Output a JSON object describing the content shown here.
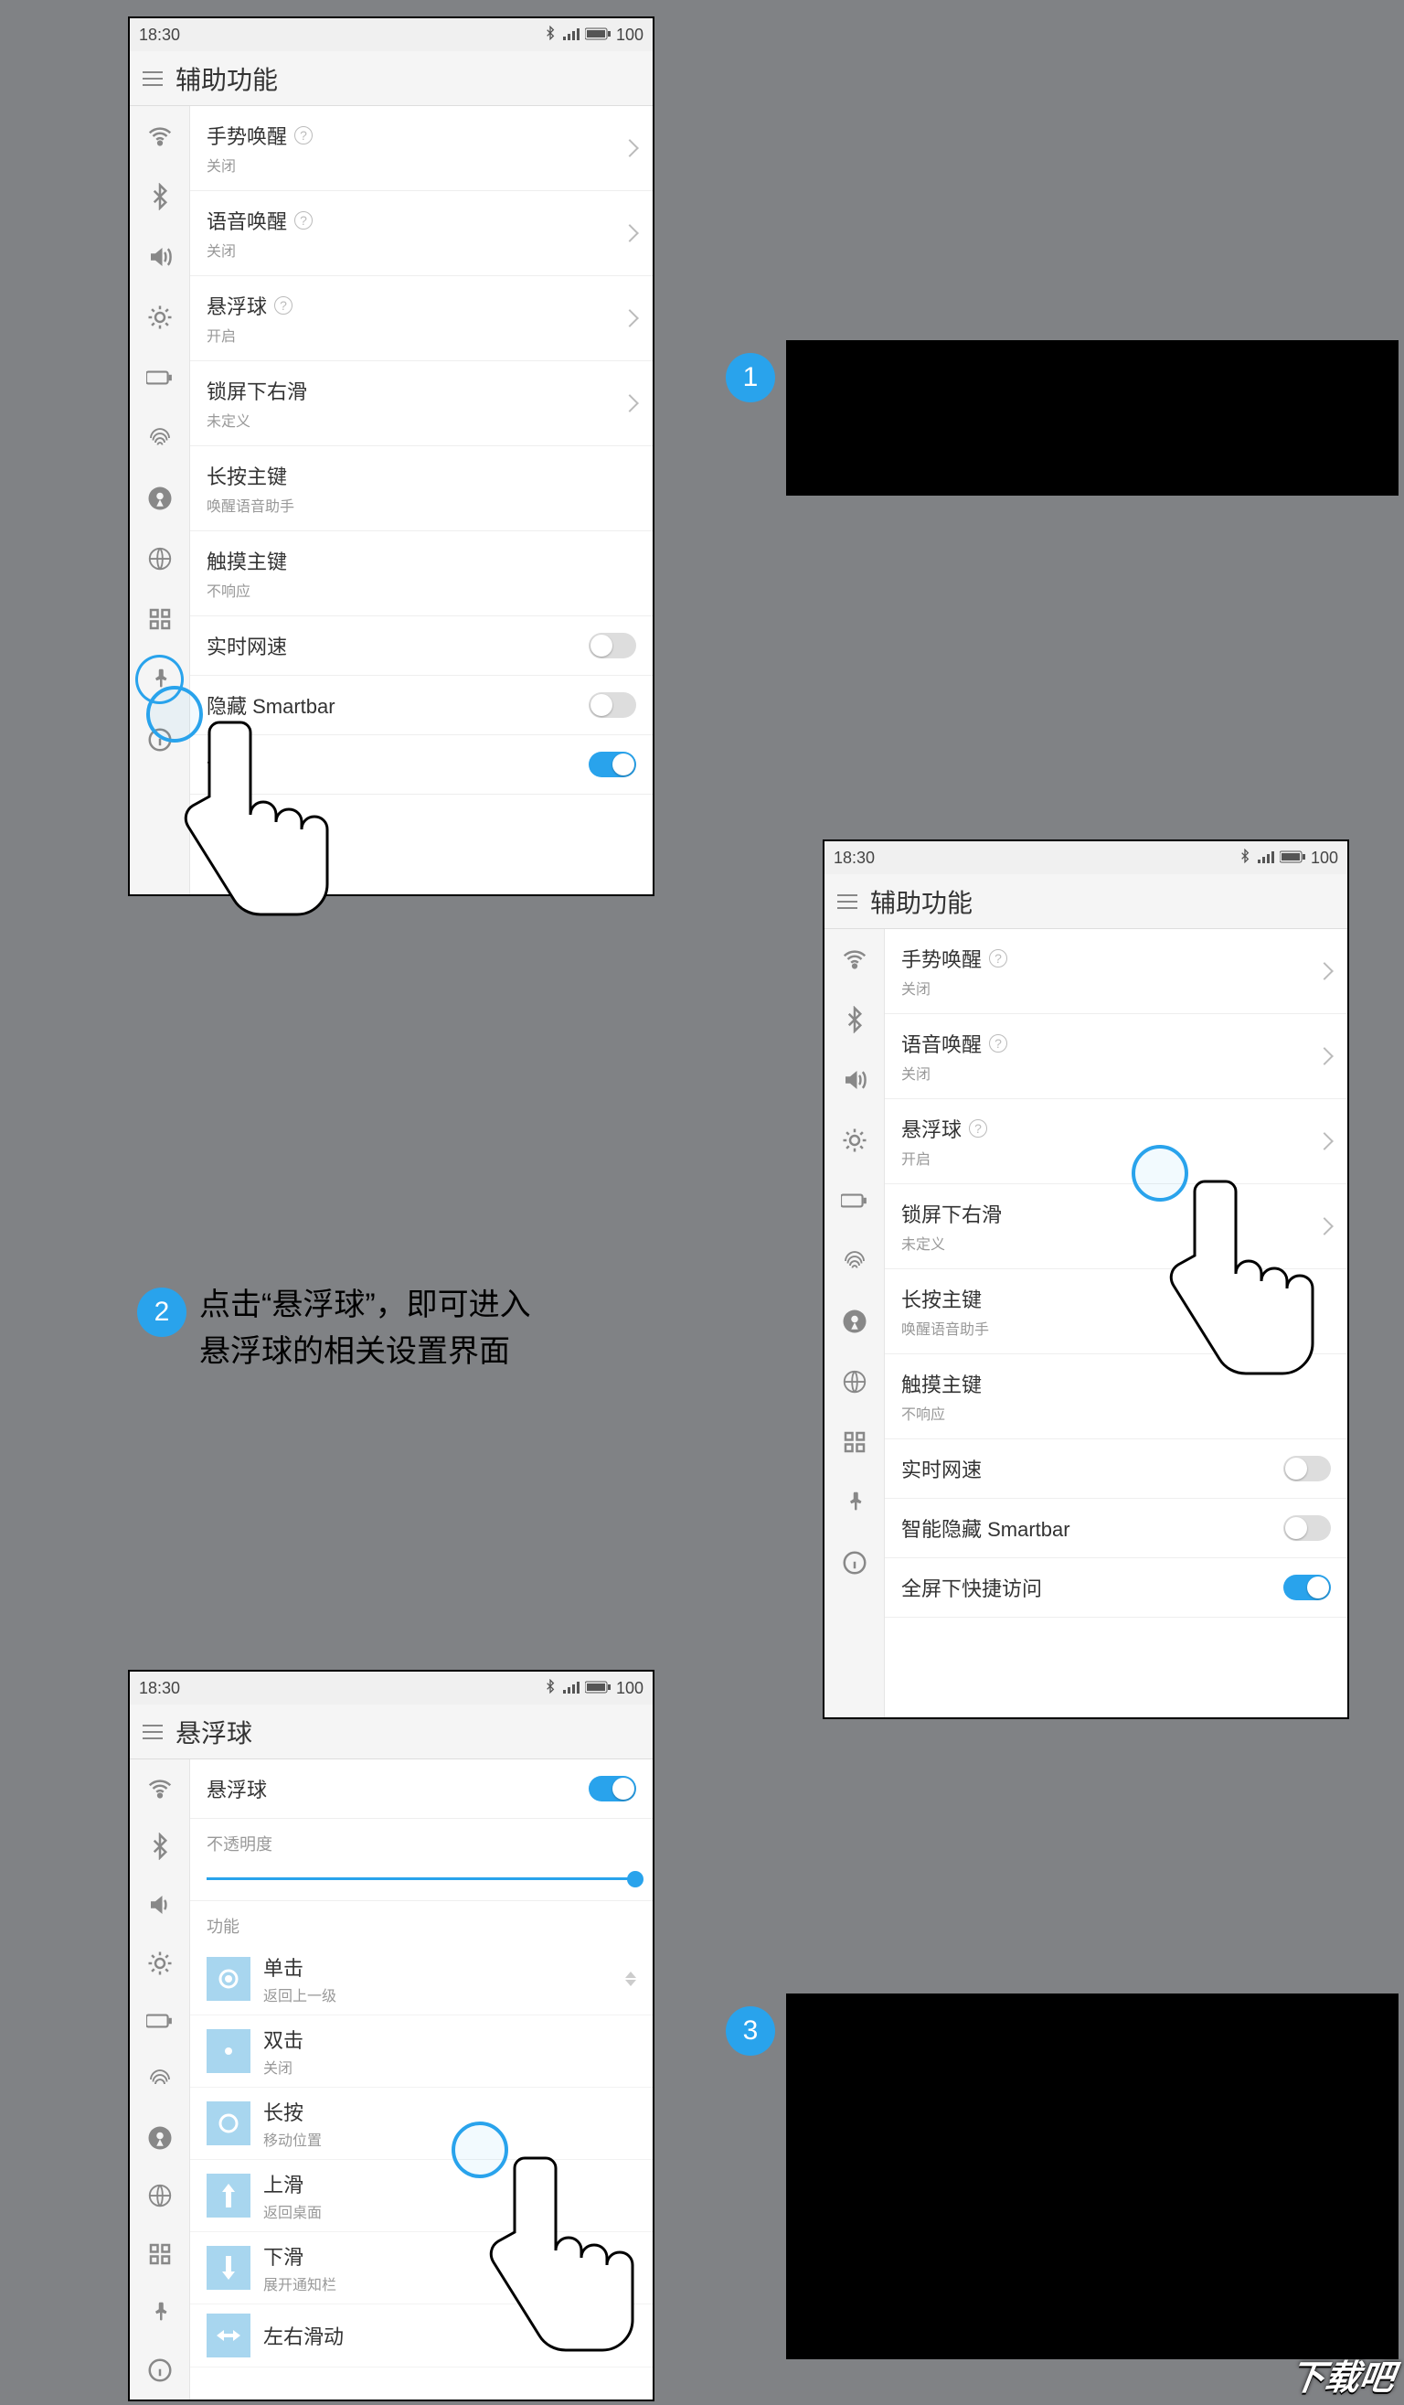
{
  "status": {
    "time": "18:30",
    "battery": "100"
  },
  "screens": {
    "accessibility_title": "辅助功能",
    "float_title": "悬浮球"
  },
  "rows": {
    "gesture_wake": {
      "title": "手势唤醒",
      "sub": "关闭"
    },
    "voice_wake": {
      "title": "语音唤醒",
      "sub": "关闭"
    },
    "float_ball": {
      "title": "悬浮球",
      "sub": "开启"
    },
    "lock_swipe": {
      "title": "锁屏下右滑",
      "sub": "未定义"
    },
    "long_home": {
      "title": "长按主键",
      "sub": "唤醒语音助手"
    },
    "touch_home": {
      "title": "触摸主键",
      "sub": "不响应"
    },
    "net_speed": {
      "title": "实时网速"
    },
    "smartbar": {
      "title": "智能隐藏 Smartbar"
    },
    "smartbar_partial": {
      "title": "隐藏 Smartbar"
    },
    "quick_access": {
      "title": "全屏下快捷访问"
    },
    "quick_access_partial": {
      "title": "访问"
    }
  },
  "float_settings": {
    "toggle_label": "悬浮球",
    "opacity_label": "不透明度",
    "functions_label": "功能",
    "tap": {
      "title": "单击",
      "sub": "返回上一级"
    },
    "double_tap": {
      "title": "双击",
      "sub": "关闭"
    },
    "long_press": {
      "title": "长按",
      "sub": "移动位置"
    },
    "swipe_up": {
      "title": "上滑",
      "sub": "返回桌面"
    },
    "swipe_down": {
      "title": "下滑",
      "sub": "展开通知栏"
    },
    "swipe_lr": {
      "title": "左右滑动"
    }
  },
  "steps": {
    "s1": "1",
    "s2": "2",
    "s2_text": "点击“悬浮球”，即可进入\n悬浮球的相关设置界面",
    "s3": "3"
  },
  "watermark": "下载吧"
}
